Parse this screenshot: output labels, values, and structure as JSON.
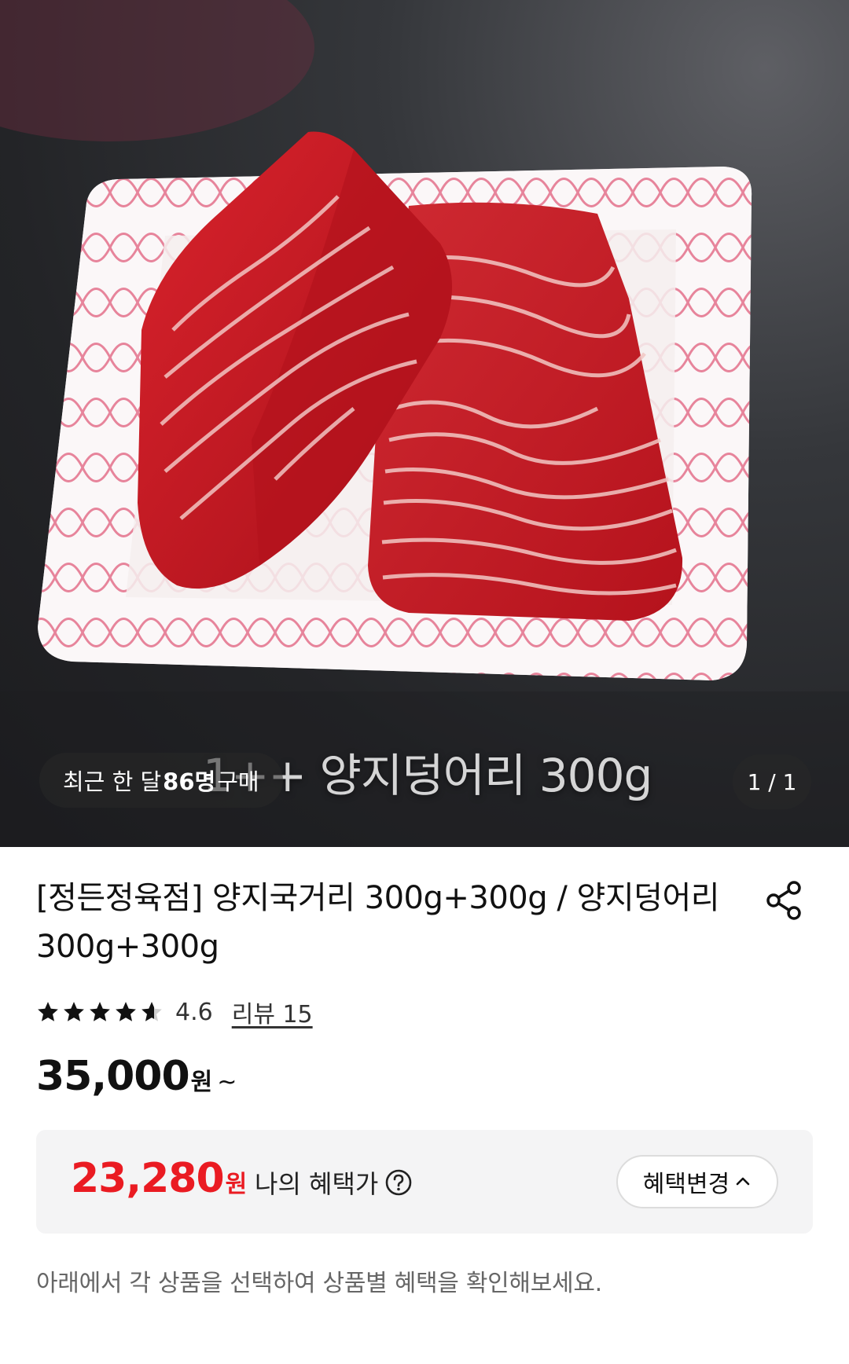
{
  "hero": {
    "caption_text": "1++ 양지덩어리 300g",
    "buyers": {
      "prefix": "최근 한 달 ",
      "count": "86명",
      "suffix": " 구매"
    },
    "counter": "1 / 1"
  },
  "product": {
    "title": "[정든정육점] 양지국거리 300g+300g / 양지덩어리 300g+300g",
    "rating": 4.6,
    "rating_text": "4.6",
    "review_link": "리뷰 15",
    "price": "35,000",
    "price_unit": "원",
    "price_suffix": "~"
  },
  "benefit": {
    "price": "23,280",
    "price_unit": "원",
    "label": "나의 혜택가",
    "change_button": "혜택변경"
  },
  "notice": "아래에서 각 상품을 선택하여 상품별 혜택을 확인해보세요.",
  "colors": {
    "accent_red": "#ea1b22",
    "benefit_bg": "#f4f4f5",
    "hero_bg": "#2a2b2e",
    "meat": "#c8161e"
  },
  "icons": [
    "share-icon",
    "star-icon",
    "help-circle-icon",
    "chevron-up-icon"
  ]
}
